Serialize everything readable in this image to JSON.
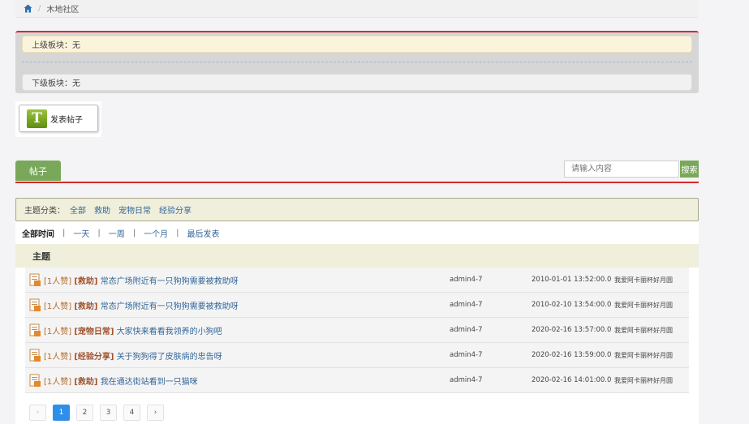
{
  "breadcrumb": {
    "home_icon": "home-icon",
    "current": "木地社区"
  },
  "board": {
    "parent_label": "上级板块：",
    "parent_value": "无",
    "child_label": "下级板块：",
    "child_value": "无"
  },
  "post_button": {
    "icon": "T",
    "label": "发表帖子"
  },
  "tab": {
    "label": "帖子"
  },
  "search": {
    "placeholder": "请输入内容",
    "button_label": "搜索"
  },
  "categories": {
    "label": "主题分类：",
    "items": [
      "全部",
      "救助",
      "宠物日常",
      "经验分享"
    ]
  },
  "time_filters": {
    "items": [
      "全部时间",
      "一天",
      "一周",
      "一个月",
      "最后发表"
    ],
    "active": "全部时间"
  },
  "table": {
    "header": "主题"
  },
  "topics": [
    {
      "zan": "[1人赞]",
      "cat": "[救助]",
      "title": "常态广场附近有一只狗狗需要被救助呀",
      "user": "admin4-7",
      "time": "2010-01-01 13:52:00.0",
      "reply": "我爱阿卡丽杯好月圆"
    },
    {
      "zan": "[1人赞]",
      "cat": "[救助]",
      "title": "常态广场附近有一只狗狗需要被救助呀",
      "user": "admin4-7",
      "time": "2010-02-10 13:54:00.0",
      "reply": "我爱阿卡丽杯好月圆"
    },
    {
      "zan": "[1人赞]",
      "cat": "[宠物日常]",
      "title": "大家快来看看我领养的小狗吧",
      "user": "admin4-7",
      "time": "2020-02-16 13:57:00.0",
      "reply": "我爱阿卡丽杯好月圆"
    },
    {
      "zan": "[1人赞]",
      "cat": "[经验分享]",
      "title": "关于狗狗得了皮肤病的忠告呀",
      "user": "admin4-7",
      "time": "2020-02-16 13:59:00.0",
      "reply": "我爱阿卡丽杯好月圆"
    },
    {
      "zan": "[1人赞]",
      "cat": "[救助]",
      "title": "我在通达街站看到一只猫咪",
      "user": "admin4-7",
      "time": "2020-02-16 14:01:00.0",
      "reply": "我爱阿卡丽杯好月圆"
    }
  ],
  "pagination": {
    "prev": "‹",
    "pages": [
      "1",
      "2",
      "3",
      "4"
    ],
    "next": "›",
    "current": "1"
  },
  "colors": {
    "accent_red": "#d42b2b",
    "tab_green": "#7aa85a",
    "link_blue": "#336699",
    "page_active": "#2f8fe8"
  }
}
